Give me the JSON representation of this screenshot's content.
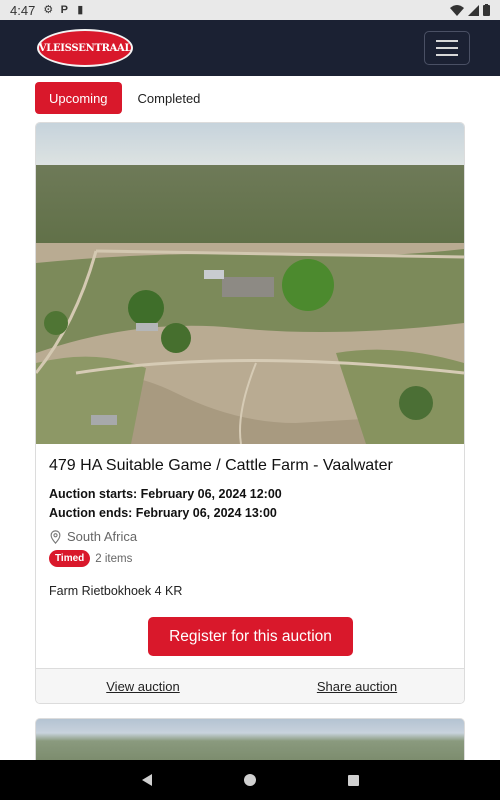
{
  "status_bar": {
    "time": "4:47",
    "icons": [
      "gear-icon",
      "parking-icon",
      "sd-card-icon",
      "wifi-icon",
      "signal-icon",
      "battery-icon"
    ]
  },
  "header": {
    "logo_text": "VLEISSENTRAAL",
    "menu_icon": "hamburger-menu-icon",
    "bg_color": "#1b2133",
    "brand_color": "#d9182b"
  },
  "tabs": [
    {
      "label": "Upcoming",
      "active": true
    },
    {
      "label": "Completed",
      "active": false
    }
  ],
  "auction": {
    "title": "479 HA Suitable Game / Cattle Farm - Vaalwater",
    "starts": "Auction starts: February 06, 2024 12:00",
    "ends": "Auction ends: February 06, 2024 13:00",
    "location": "South Africa",
    "type_badge": "Timed",
    "items": "2 items",
    "description": "Farm Rietbokhoek 4 KR",
    "register_label": "Register for this auction",
    "view_label": "View auction",
    "share_label": "Share auction"
  },
  "nav_bar": {
    "icons": [
      "back-icon",
      "home-icon",
      "recents-icon"
    ]
  }
}
